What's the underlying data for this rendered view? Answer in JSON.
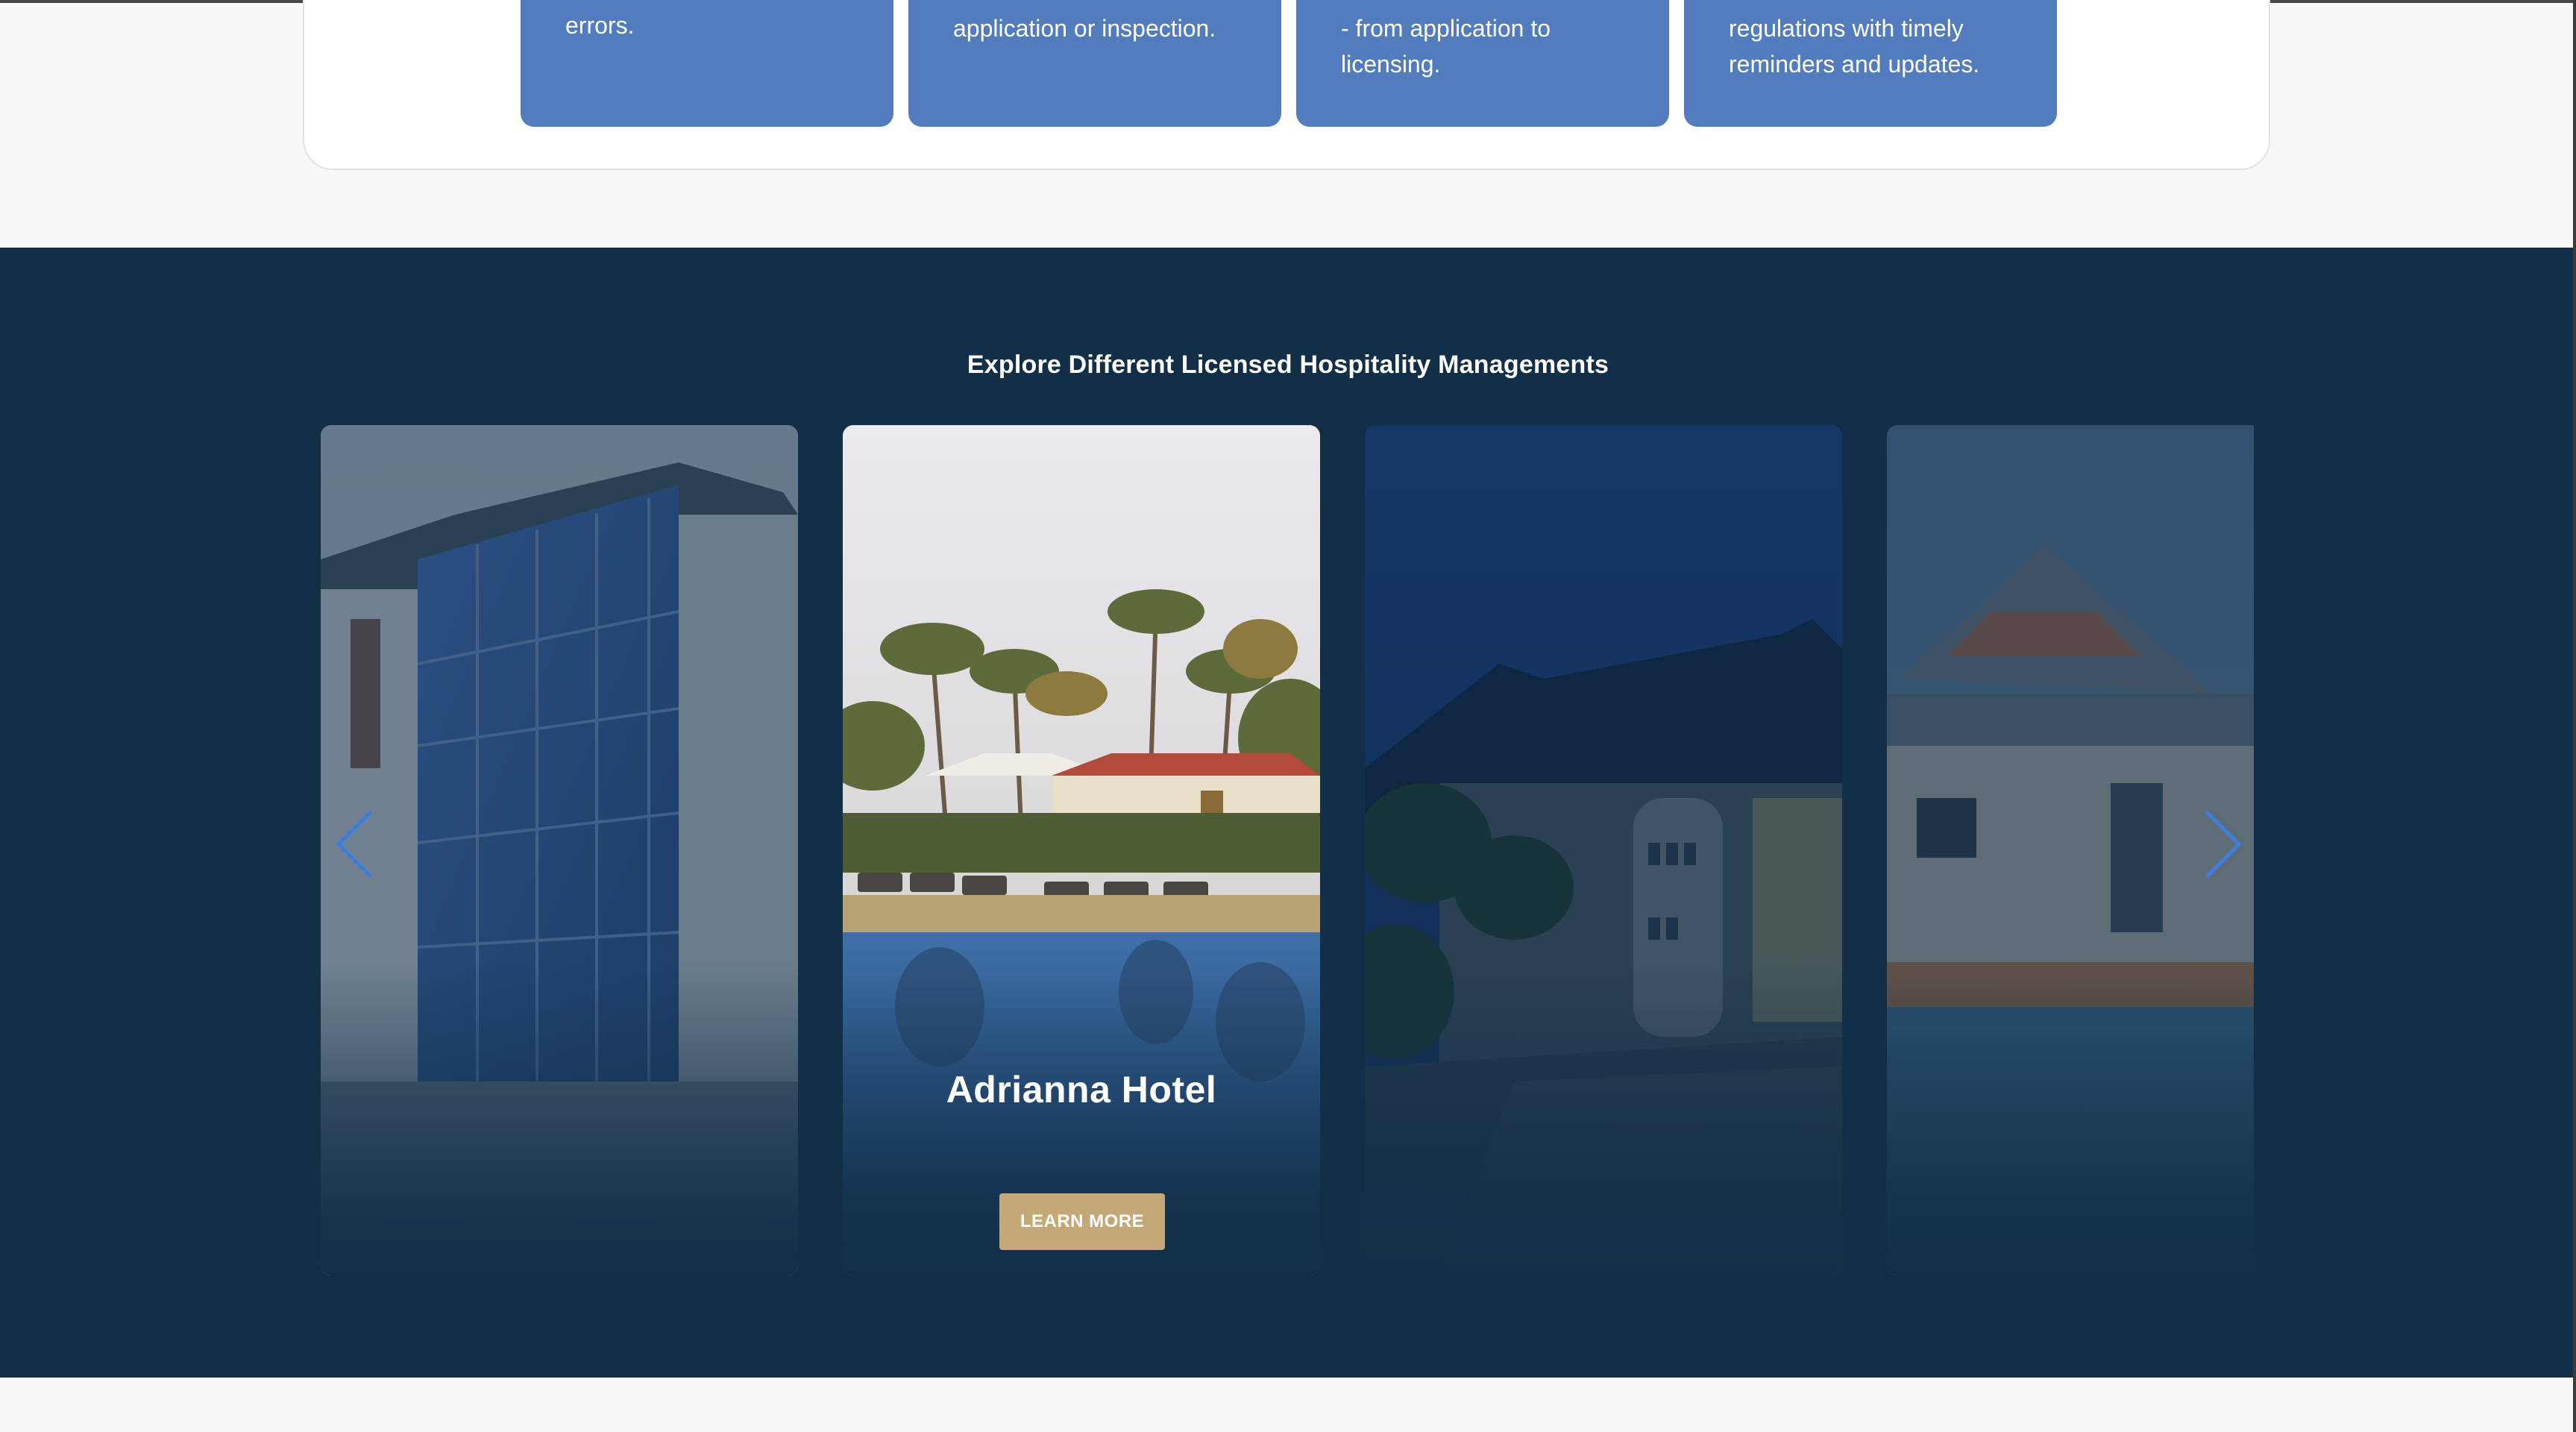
{
  "features": {
    "cards": [
      {
        "text": "errors."
      },
      {
        "text": "application or inspection."
      },
      {
        "text": "- from application to\nlicensing."
      },
      {
        "text": "regulations with timely\nreminders and updates."
      }
    ]
  },
  "hospitality": {
    "title": "Explore Different Licensed Hospitality Managements",
    "active_slide": {
      "name": "Adrianna Hotel",
      "button_label": "LEARN MORE"
    },
    "arrows": {
      "prev_icon": "chevron-left-icon",
      "next_icon": "chevron-right-icon"
    }
  },
  "colors": {
    "section_bg": "#122f47",
    "feature_card": "#527cbd",
    "button": "#c4a877",
    "arrow": "#3d7de0"
  }
}
